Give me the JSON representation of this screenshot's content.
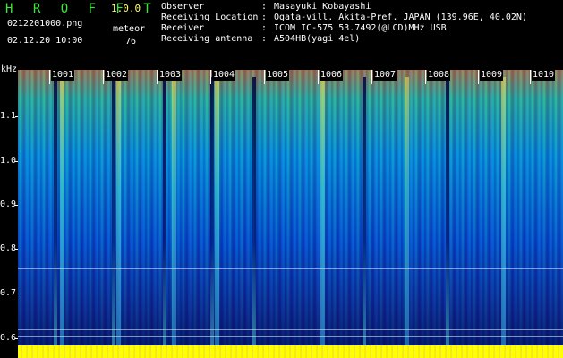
{
  "header": {
    "app_title": "H R O F F T",
    "app_version": "1.0.0",
    "file_name": "0212201000.png",
    "date_time": "02.12.20 10:00",
    "type_label": "meteor",
    "type_count": "76",
    "info": [
      {
        "key": "Observer",
        "value": "Masayuki Kobayashi"
      },
      {
        "key": "Receiving Location",
        "value": "Ogata-vill. Akita-Pref. JAPAN (139.96E, 40.02N)"
      },
      {
        "key": "Receiver",
        "value": "ICOM IC-575 53.7492(@LCD)MHz USB"
      },
      {
        "key": "Receiving antenna",
        "value": "A504HB(yagi 4el)"
      }
    ],
    "separator": ":"
  },
  "y_axis": {
    "unit": "kHz",
    "labels": [
      "1.1",
      "1.0",
      "0.9",
      "0.8",
      "0.7",
      "0.6"
    ]
  },
  "minute_marks": [
    "1001",
    "1002",
    "1003",
    "1004",
    "1005",
    "1006",
    "1007",
    "1008",
    "1009",
    "1010"
  ],
  "colors": {
    "title": "#39e639",
    "version": "#ffff66",
    "baseline": "#ffff00"
  }
}
